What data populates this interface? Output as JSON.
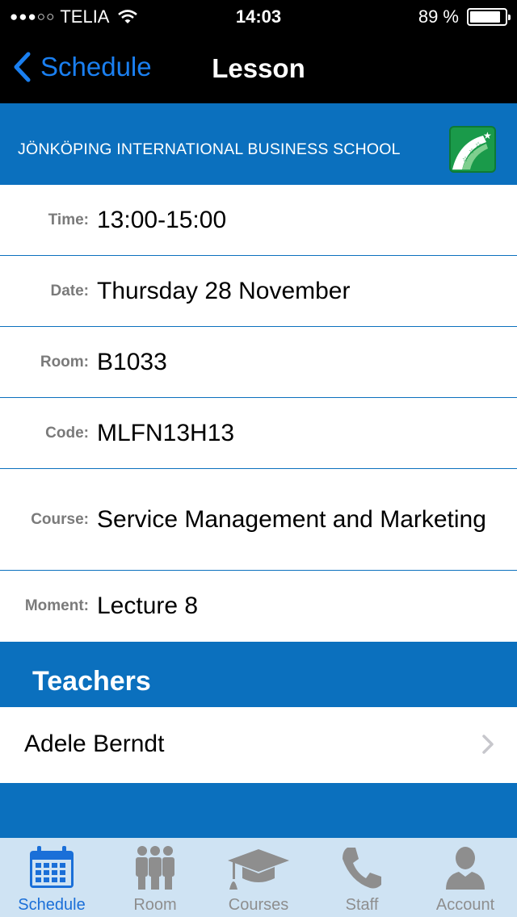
{
  "status_bar": {
    "signal": "●●●○○",
    "carrier": "TELIA",
    "time": "14:03",
    "battery_text": "89 %",
    "battery_level": 0.89
  },
  "nav": {
    "back_label": "Schedule",
    "title": "Lesson"
  },
  "banner": {
    "school_name": "JÖNKÖPING INTERNATIONAL BUSINESS SCHOOL"
  },
  "details": [
    {
      "label": "Time:",
      "value": "13:00-15:00"
    },
    {
      "label": "Date:",
      "value": "Thursday 28 November"
    },
    {
      "label": "Room:",
      "value": "B1033"
    },
    {
      "label": "Code:",
      "value": "MLFN13H13"
    },
    {
      "label": "Course:",
      "value": "Service Management and Marketing"
    },
    {
      "label": "Moment:",
      "value": "Lecture 8"
    }
  ],
  "teachers": {
    "header": "Teachers",
    "items": [
      {
        "name": "Adele Berndt"
      }
    ]
  },
  "tabs": [
    {
      "label": "Schedule",
      "icon": "calendar-icon",
      "active": true
    },
    {
      "label": "Room",
      "icon": "people-icon",
      "active": false
    },
    {
      "label": "Courses",
      "icon": "graduation-cap-icon",
      "active": false
    },
    {
      "label": "Staff",
      "icon": "phone-icon",
      "active": false
    },
    {
      "label": "Account",
      "icon": "user-icon",
      "active": false
    }
  ],
  "colors": {
    "accent_blue": "#0b70be",
    "link_blue": "#1a7ff0",
    "tab_bar_bg": "#cfe3f3",
    "logo_green": "#1a9a4a"
  }
}
